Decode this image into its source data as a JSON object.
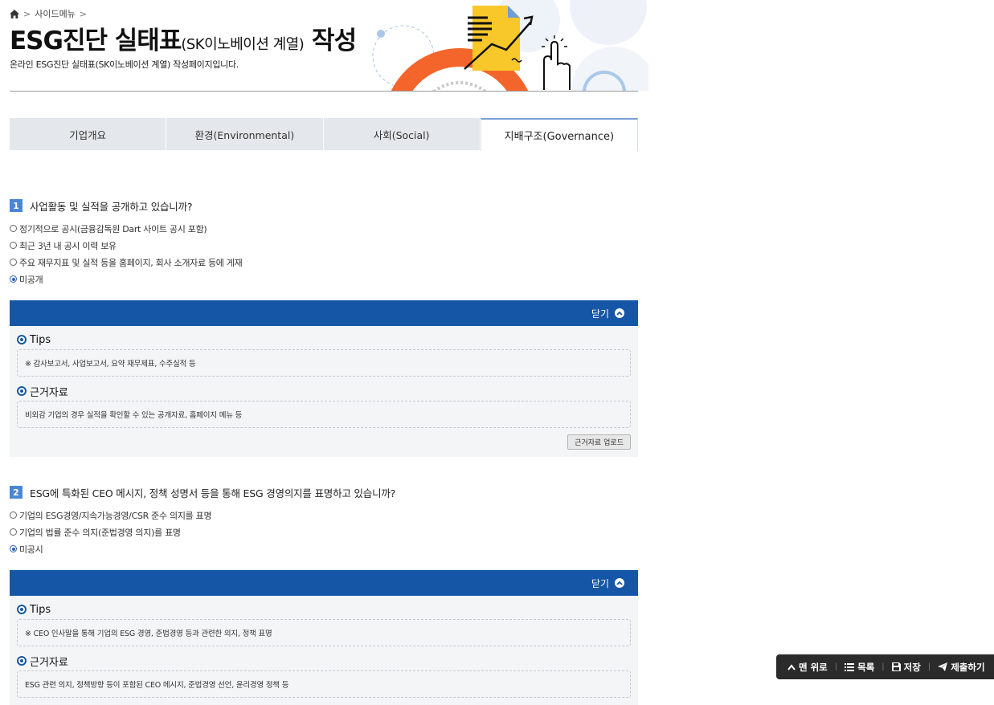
{
  "breadcrumb": {
    "home_icon": "home-icon",
    "item": "사이드메뉴"
  },
  "page": {
    "title_main": "ESG진단 실태표",
    "title_sub": "(SK이노베이션 계열)",
    "title_tail": " 작성",
    "description": "온라인 ESG진단 실태표(SK이노베이션 계열) 작성페이지입니다."
  },
  "tabs": [
    {
      "label": "기업개요",
      "active": false
    },
    {
      "label": "환경(Environmental)",
      "active": false
    },
    {
      "label": "사회(Social)",
      "active": false
    },
    {
      "label": "지배구조(Governance)",
      "active": true
    }
  ],
  "questions": [
    {
      "number": "1",
      "text": "사업활동 및 실적을 공개하고 있습니까?",
      "options": [
        {
          "label": "정기적으로 공시(금융감독원 Dart 사이트 공시 포함)",
          "checked": false
        },
        {
          "label": "최근 3년 내 공시 이력 보유",
          "checked": false
        },
        {
          "label": "주요 재무지표 및 실적 등을 홈페이지, 회사 소개자료 등에 게재",
          "checked": false
        },
        {
          "label": "미공개",
          "checked": true
        }
      ],
      "panel_toggle": "닫기",
      "tips_title": "Tips",
      "tips_text": "※ 감사보고서, 사업보고서, 요약 재무제표, 수주실적 등",
      "evidence_title": "근거자료",
      "evidence_text": "비외감 기업의 경우 실적을 확인할 수 있는 공개자료, 홈페이지 메뉴 등",
      "upload_label": "근거자료 업로드"
    },
    {
      "number": "2",
      "text": "ESG에 특화된 CEO 메시지, 정책 성명서 등을 통해 ESG 경영의지를 표명하고 있습니까?",
      "options": [
        {
          "label": "기업의 ESG경영/지속가능경영/CSR 준수 의지를 표명",
          "checked": false
        },
        {
          "label": "기업의 법률 준수 의지(준법경영 의지)를 표명",
          "checked": false
        },
        {
          "label": "미공시",
          "checked": true
        }
      ],
      "panel_toggle": "닫기",
      "tips_title": "Tips",
      "tips_text": "※ CEO 인사말을 통해 기업의 ESG 경영, 준법경영 등과 관련한 의지, 정책 표명",
      "evidence_title": "근거자료",
      "evidence_text": "ESG 관련 의지, 정책방향 등이 포함된 CEO 메시지, 준법경영 선언, 윤리경영 정책 등"
    }
  ],
  "float_bar": {
    "top": "맨 위로",
    "list": "목록",
    "save": "저장",
    "submit": "제출하기"
  },
  "colors": {
    "panel_bar": "#1656a6",
    "question_badge": "#4a86d6",
    "tab_inactive": "#e4e7eb",
    "float_bar": "#2b2b2b"
  }
}
